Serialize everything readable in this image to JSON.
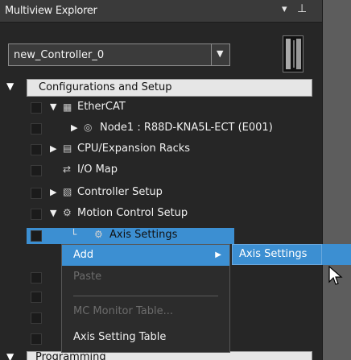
{
  "panel": {
    "title": "Multiview Explorer",
    "pin_icon": "pin-icon",
    "dropdown_icon": "chevron-down-icon"
  },
  "controller": {
    "selected": "new_Controller_0"
  },
  "tree": {
    "configurations": "Configurations and Setup",
    "ethercat": "EtherCAT",
    "node1": "Node1 : R88D-KNA5L-ECT (E001)",
    "cpu_racks": "CPU/Expansion Racks",
    "io_map": "I/O Map",
    "controller_setup": "Controller Setup",
    "motion_control_setup": "Motion Control Setup",
    "axis_settings": "Axis Settings",
    "programming": "Programming"
  },
  "context_menu": {
    "items": [
      {
        "label": "Add",
        "state": "active"
      },
      {
        "label": "Paste",
        "state": "disabled"
      },
      {
        "label": "MC Monitor Table...",
        "state": "disabled"
      },
      {
        "label": "Axis Setting Table",
        "state": "normal"
      }
    ],
    "submenu_item": "Axis Settings"
  },
  "colors": {
    "selection": "#3c8fd2",
    "background": "#262626"
  }
}
